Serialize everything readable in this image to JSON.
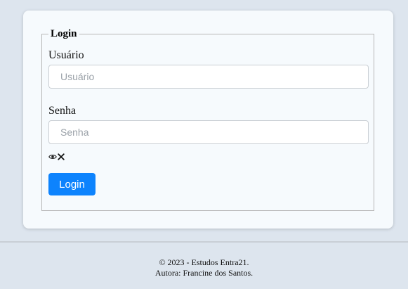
{
  "form": {
    "legend": "Login",
    "username_label": "Usuário",
    "username_placeholder": "Usuário",
    "username_value": "",
    "password_label": "Senha",
    "password_placeholder": "Senha",
    "password_value": "",
    "toggle_icon": "eye-slash-icon",
    "submit_label": "Login"
  },
  "footer": {
    "copyright": "© 2023 - Estudos Entra21.",
    "author": "Autora: Francine dos Santos."
  },
  "colors": {
    "background": "#dde5ee",
    "card": "#f6fafd",
    "primary_button": "#0d83fd"
  }
}
